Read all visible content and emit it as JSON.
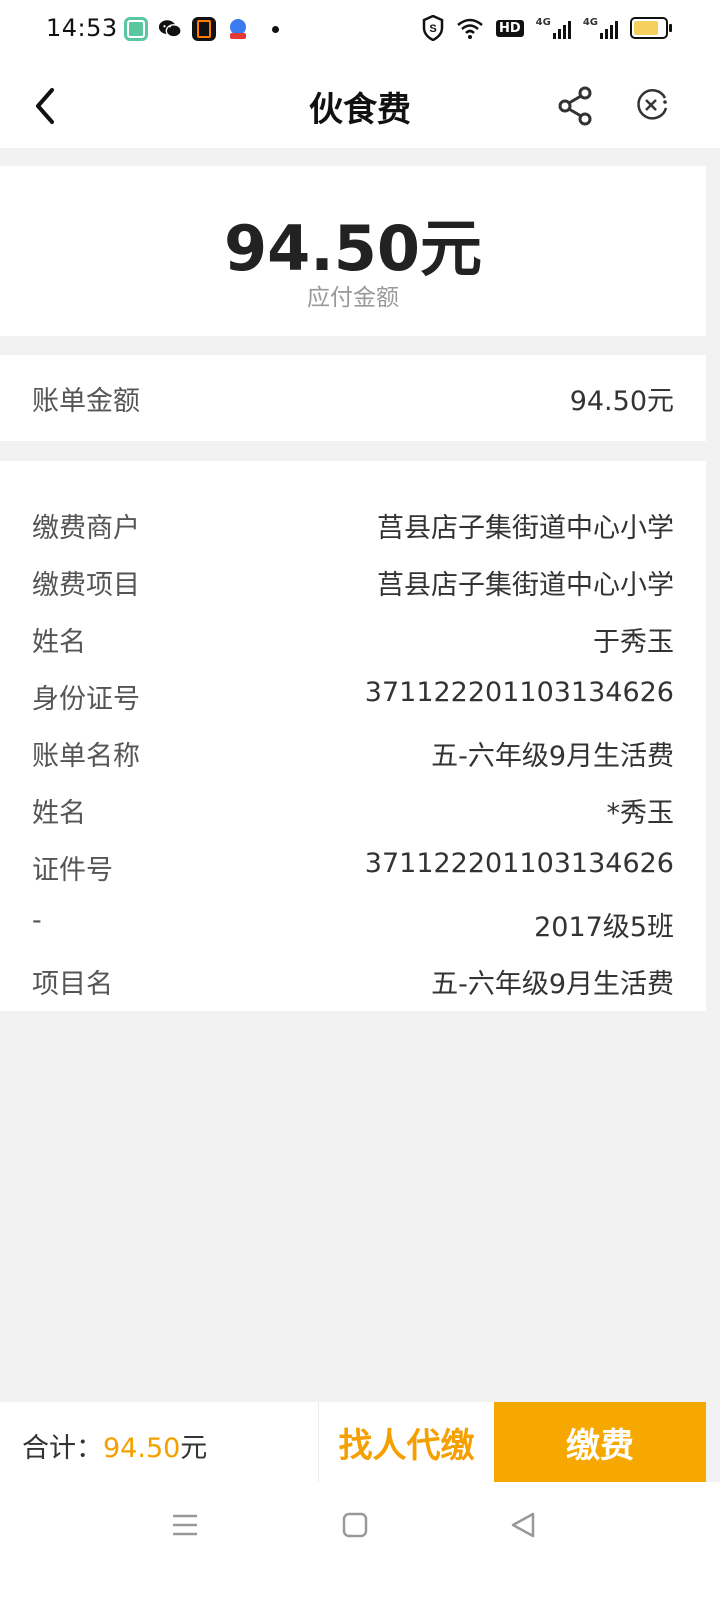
{
  "status_bar": {
    "time": "14:53",
    "left_icons": [
      "app-green-icon",
      "wechat-icon",
      "app-orange-icon",
      "baidu-maps-icon",
      "dot-icon"
    ],
    "right_icons": [
      "shield-icon",
      "wifi-icon",
      "hd-icon",
      "signal-4g-icon",
      "signal-4g-icon",
      "battery-icon"
    ],
    "hd_label": "HD",
    "net_label": "4G"
  },
  "nav": {
    "title": "伙食费"
  },
  "amount": {
    "value": "94.50元",
    "label": "应付金额"
  },
  "bill": {
    "label": "账单金额",
    "value": "94.50元"
  },
  "details": [
    {
      "label": "缴费商户",
      "value": "莒县店子集街道中心小学"
    },
    {
      "label": "缴费项目",
      "value": "莒县店子集街道中心小学"
    },
    {
      "label": "姓名",
      "value": "于秀玉"
    },
    {
      "label": "身份证号",
      "value": "371122201103134626"
    },
    {
      "label": "账单名称",
      "value": "五-六年级9月生活费"
    },
    {
      "label": "姓名",
      "value": "*秀玉"
    },
    {
      "label": "证件号",
      "value": "371122201103134626"
    },
    {
      "label": "-",
      "value": "2017级5班"
    },
    {
      "label": "项目名",
      "value": "五-六年级9月生活费"
    }
  ],
  "bottom": {
    "total_label": "合计：",
    "total_amount": "94.50",
    "total_unit": "元",
    "proxy_pay": "找人代缴",
    "pay": "缴费"
  },
  "colors": {
    "accent": "#f7a800",
    "accent_text": "#f5a000",
    "background": "#f2f2f2"
  }
}
